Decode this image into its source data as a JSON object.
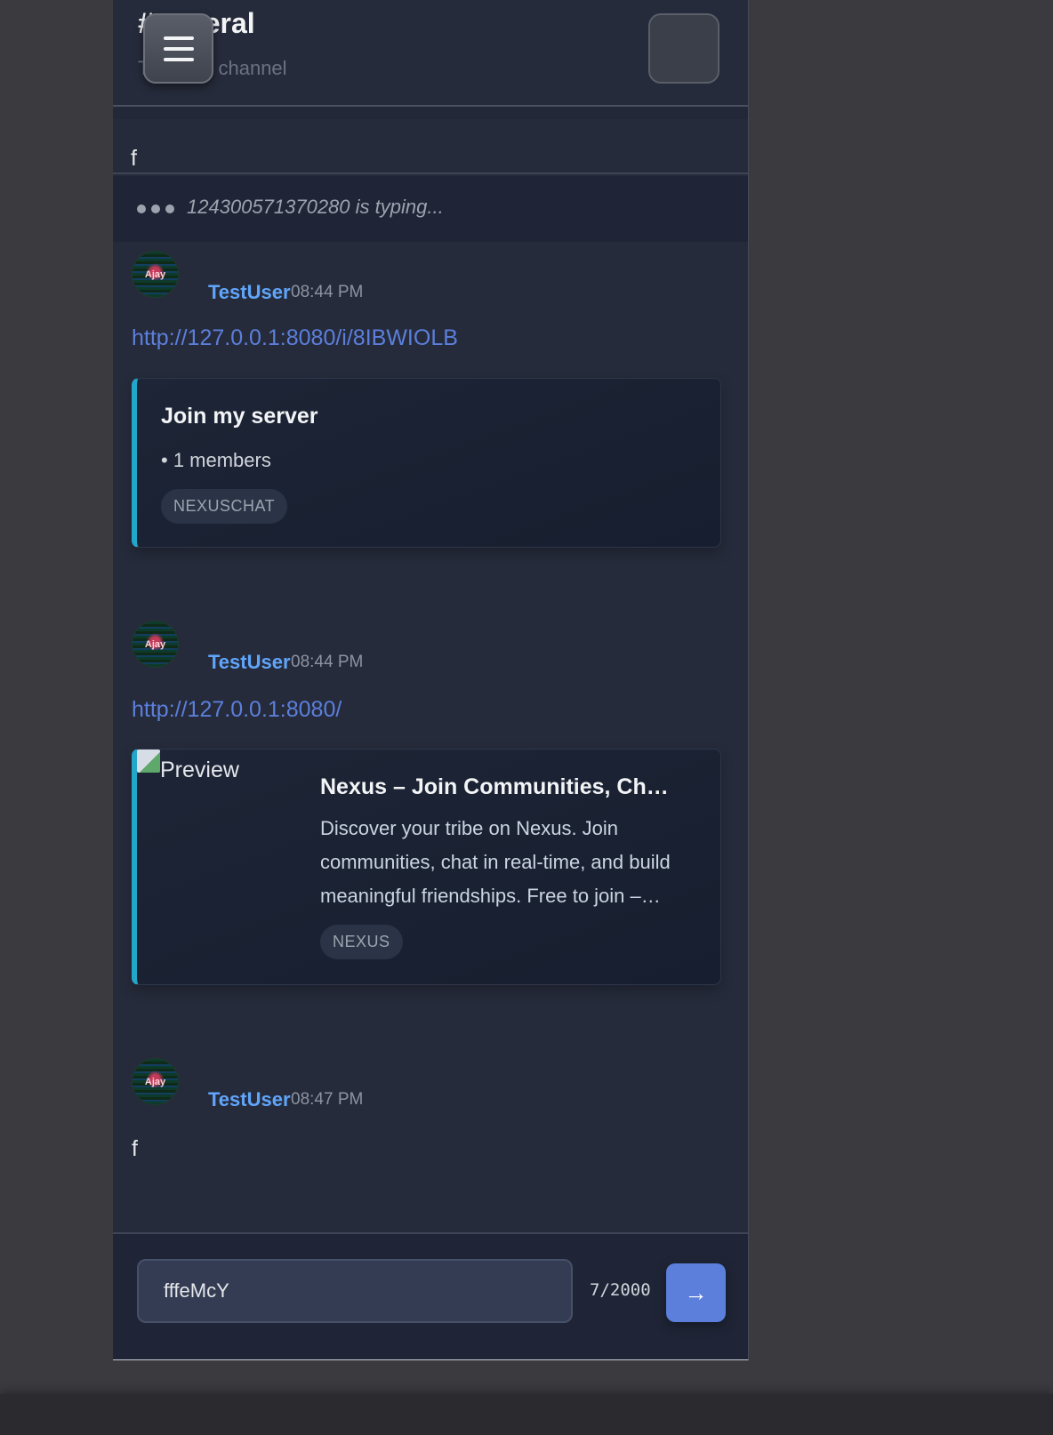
{
  "header": {
    "channel_name": "#general",
    "channel_topic": "The only channel"
  },
  "pinned": {
    "text": "f"
  },
  "typing": {
    "text": "124300571370280 is typing..."
  },
  "messages": [
    {
      "author": "TestUser",
      "time": "08:44 PM",
      "avatar_text": "Ajay",
      "link": "http://127.0.0.1:8080/i/8IBWIOLB",
      "embed": {
        "title": "Join my server",
        "subtitle": "• 1 members",
        "tag": "NEXUSCHAT"
      }
    },
    {
      "author": "TestUser",
      "time": "08:44 PM",
      "avatar_text": "Ajay",
      "link": "http://127.0.0.1:8080/",
      "embed": {
        "image_alt": "Preview",
        "title": "Nexus – Join Communities, Ch…",
        "description_lines": [
          "Discover your tribe on Nexus. Join",
          "communities, chat in real-time, and build",
          "meaningful friendships. Free to join –…"
        ],
        "tag": "NEXUS"
      }
    },
    {
      "author": "TestUser",
      "time": "08:47 PM",
      "avatar_text": "Ajay",
      "text": "f"
    }
  ],
  "composer": {
    "value": "fffeMcY",
    "counter": "7/2000",
    "send_icon": "→"
  },
  "colors": {
    "accent": "#5b7fdb",
    "username": "#60a5fa",
    "embed_border": "#22a6c9",
    "background": "#262b3b"
  }
}
